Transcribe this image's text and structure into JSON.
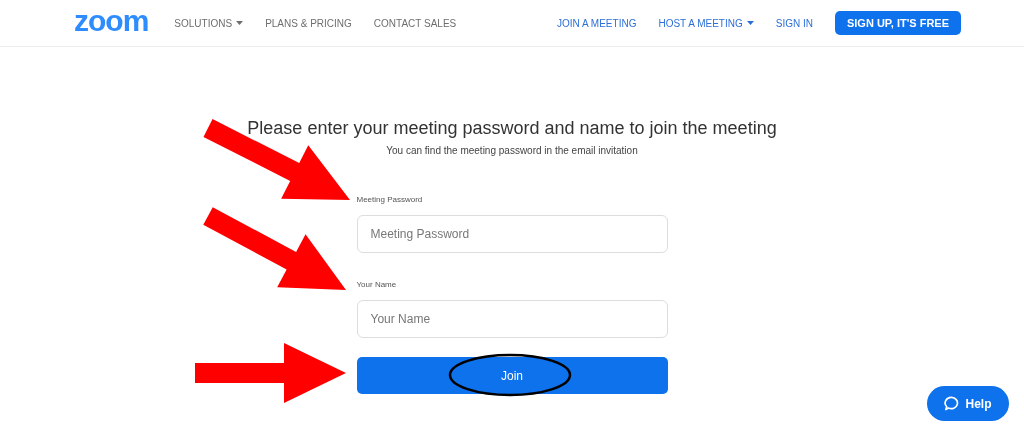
{
  "header": {
    "logo": "zoom",
    "nav_left": [
      {
        "label": "SOLUTIONS",
        "dropdown": true
      },
      {
        "label": "PLANS & PRICING",
        "dropdown": false
      },
      {
        "label": "CONTACT SALES",
        "dropdown": false
      }
    ],
    "nav_right": [
      {
        "label": "JOIN A MEETING",
        "dropdown": false
      },
      {
        "label": "HOST A MEETING",
        "dropdown": true
      },
      {
        "label": "SIGN IN",
        "dropdown": false
      }
    ],
    "signup_button": "SIGN UP, IT'S FREE"
  },
  "form": {
    "title": "Please enter your meeting password and name to join the meeting",
    "subtitle": "You can find the meeting password in the email invitation",
    "fields": [
      {
        "label": "Meeting Password",
        "placeholder": "Meeting Password"
      },
      {
        "label": "Your Name",
        "placeholder": "Your Name"
      }
    ],
    "submit_button": "Join"
  },
  "help_button": "Help"
}
